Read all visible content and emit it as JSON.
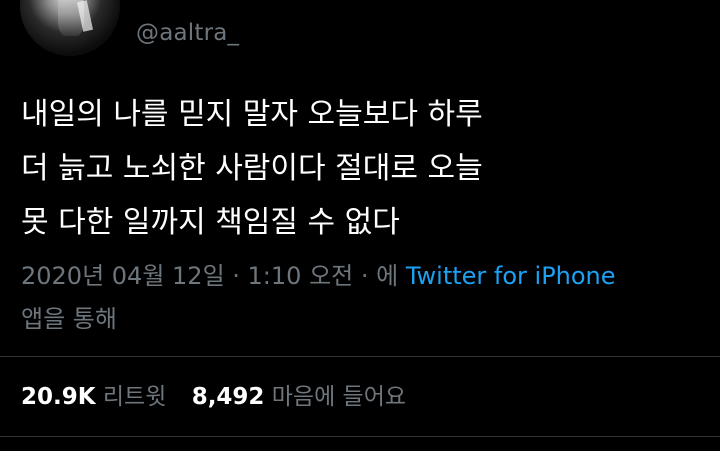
{
  "author": {
    "handle": "@aaltra_"
  },
  "tweet": {
    "lines": [
      "내일의 나를 믿지 말자 오늘보다 하루",
      "더 늙고 노쇠한 사람이다 절대로 오늘",
      "못 다한 일까지 책임질 수 없다"
    ]
  },
  "meta": {
    "timestamp": "2020년 04월 12일 · 1:10 오전 · 에 ",
    "source_link": "Twitter for iPhone",
    "suffix": " 앱을 통해"
  },
  "stats": {
    "retweets_count": "20.9K",
    "retweets_label": "리트윗",
    "likes_count": "8,492",
    "likes_label": "마음에 들어요"
  },
  "colors": {
    "background": "#000000",
    "text": "#ffffff",
    "secondary": "#6e767d",
    "link": "#1da1f2",
    "divider": "#2f3336"
  }
}
